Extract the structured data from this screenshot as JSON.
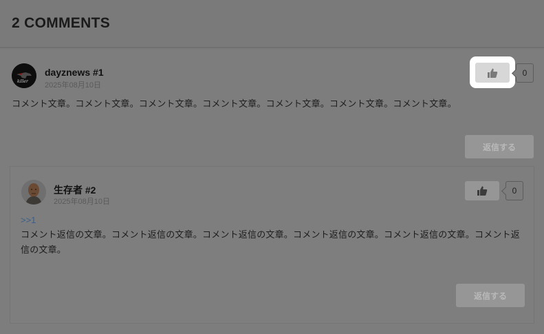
{
  "section": {
    "title": "2 COMMENTS"
  },
  "comment": {
    "author": "dayznews #1",
    "date": "2025年08月10日",
    "body": "コメント文章。コメント文章。コメント文章。コメント文章。コメント文章。コメント文章。コメント文章。",
    "likes": "0",
    "reply_label": "返信する"
  },
  "reply": {
    "author": "生存者 #2",
    "date": "2025年08月10日",
    "quote": ">>1",
    "body": "コメント返信の文章。コメント返信の文章。コメント返信の文章。コメント返信の文章。コメント返信の文章。コメント返信の文章。",
    "likes": "0",
    "reply_label": "返信する"
  },
  "colors": {
    "overlay": "#7a7a7a",
    "highlight": "#ffffff",
    "link": "#3a5f8a"
  },
  "icons": {
    "like": "thumbs-up-icon"
  }
}
